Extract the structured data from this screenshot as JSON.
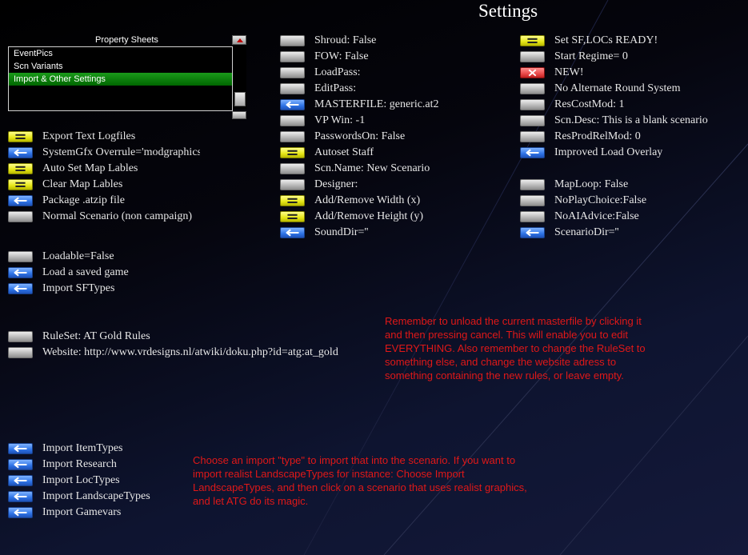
{
  "title": "Settings",
  "property_sheets": {
    "label": "Property Sheets",
    "items": [
      "EventPics",
      "Scn Variants",
      "Import & Other Settings"
    ],
    "selected": "Import & Other Settings"
  },
  "left_column": [
    {
      "icon": "equals-icon",
      "color": "yellow",
      "label": "Export Text Logfiles"
    },
    {
      "icon": "arrow-left-icon",
      "color": "blue",
      "label": "SystemGfx  Overrule='modgraphics'"
    },
    {
      "icon": "equals-icon",
      "color": "yellow",
      "label": "Auto Set Map Lables"
    },
    {
      "icon": "equals-icon",
      "color": "yellow",
      "label": "Clear Map Lables"
    },
    {
      "icon": "arrow-left-icon",
      "color": "blue",
      "label": "Package .atzip file"
    },
    {
      "icon": "blank-icon",
      "color": "gray",
      "label": "Normal Scenario  (non campaign)"
    },
    {
      "icon": "blank-icon",
      "color": "gray",
      "label": "Loadable=False"
    },
    {
      "icon": "arrow-left-icon",
      "color": "blue",
      "label": "Load a saved game"
    },
    {
      "icon": "arrow-left-icon",
      "color": "blue",
      "label": "Import SFTypes"
    },
    {
      "icon": "blank-icon",
      "color": "gray",
      "label": "RuleSet: AT Gold Rules"
    },
    {
      "icon": "blank-icon",
      "color": "gray",
      "label": "Website:  http://www.vrdesigns.nl/atwiki/doku.php?id=atg:at_gold"
    },
    {
      "icon": "arrow-left-icon",
      "color": "blue",
      "label": "Import ItemTypes"
    },
    {
      "icon": "arrow-left-icon",
      "color": "blue",
      "label": "Import Research"
    },
    {
      "icon": "arrow-left-icon",
      "color": "blue",
      "label": "Import LocTypes"
    },
    {
      "icon": "arrow-left-icon",
      "color": "blue",
      "label": "Import LandscapeTypes"
    },
    {
      "icon": "arrow-left-icon",
      "color": "blue",
      "label": "Import Gamevars"
    }
  ],
  "middle_column": [
    {
      "icon": "blank-icon",
      "color": "gray",
      "label": "Shroud: False"
    },
    {
      "icon": "blank-icon",
      "color": "gray",
      "label": "FOW: False"
    },
    {
      "icon": "blank-icon",
      "color": "gray",
      "label": "LoadPass:"
    },
    {
      "icon": "blank-icon",
      "color": "gray",
      "label": "EditPass:"
    },
    {
      "icon": "arrow-left-icon",
      "color": "blue",
      "label": "MASTERFILE: generic.at2"
    },
    {
      "icon": "blank-icon",
      "color": "gray",
      "label": "VP Win: -1"
    },
    {
      "icon": "blank-icon",
      "color": "gray",
      "label": "PasswordsOn: False"
    },
    {
      "icon": "equals-icon",
      "color": "yellow",
      "label": "Autoset Staff"
    },
    {
      "icon": "blank-icon",
      "color": "gray",
      "label": "Scn.Name: New Scenario"
    },
    {
      "icon": "blank-icon",
      "color": "gray",
      "label": "Designer:"
    },
    {
      "icon": "equals-icon",
      "color": "yellow",
      "label": "Add/Remove Width (x)"
    },
    {
      "icon": "equals-icon",
      "color": "yellow",
      "label": "Add/Remove Height (y)"
    },
    {
      "icon": "arrow-left-icon",
      "color": "blue",
      "label": " SoundDir=''"
    }
  ],
  "right_column": [
    {
      "icon": "equals-icon",
      "color": "yellow",
      "label": "Set SF,LOCs READY!"
    },
    {
      "icon": "blank-icon",
      "color": "gray",
      "label": "Start Regime= 0"
    },
    {
      "icon": "x-icon",
      "color": "red",
      "label": "NEW!"
    },
    {
      "icon": "blank-icon",
      "color": "gray",
      "label": "No Alternate Round System"
    },
    {
      "icon": "blank-icon",
      "color": "gray",
      "label": "ResCostMod:  1"
    },
    {
      "icon": "blank-icon",
      "color": "gray",
      "label": "Scn.Desc: This is a blank scenario"
    },
    {
      "icon": "blank-icon",
      "color": "gray",
      "label": "ResProdRelMod:  0"
    },
    {
      "icon": "arrow-left-icon",
      "color": "blue",
      "label": "Improved Load Overlay"
    },
    {
      "icon": "blank-icon",
      "color": "gray",
      "label": "MapLoop: False"
    },
    {
      "icon": "blank-icon",
      "color": "gray",
      "label": "NoPlayChoice:False"
    },
    {
      "icon": "blank-icon",
      "color": "gray",
      "label": "NoAIAdvice:False"
    },
    {
      "icon": "arrow-left-icon",
      "color": "blue",
      "label": "ScenarioDir=''"
    }
  ],
  "notes": {
    "masterfile": "Remember to unload the current masterfile by clicking it\nand then pressing cancel. This will enable you to edit\nEVERYTHING. Also remember to change the RuleSet to\nsomething else, and change the website adress to\nsomething containing the new rules, or leave empty.",
    "import": "Choose an import \"type\" to import that into the scenario. If you want to\nimport realist LandscapeTypes for instance: Choose Import\nLandscapeTypes, and then click on a scenario that uses realist graphics,\nand let ATG do its magic."
  },
  "colors": {
    "note_text": "#e01818",
    "selected_item": "#0b8a0b",
    "button_gray": "#b4b4b4",
    "button_yellow": "#e6e617",
    "button_blue": "#2e73e6",
    "button_red": "#e84a4a"
  }
}
